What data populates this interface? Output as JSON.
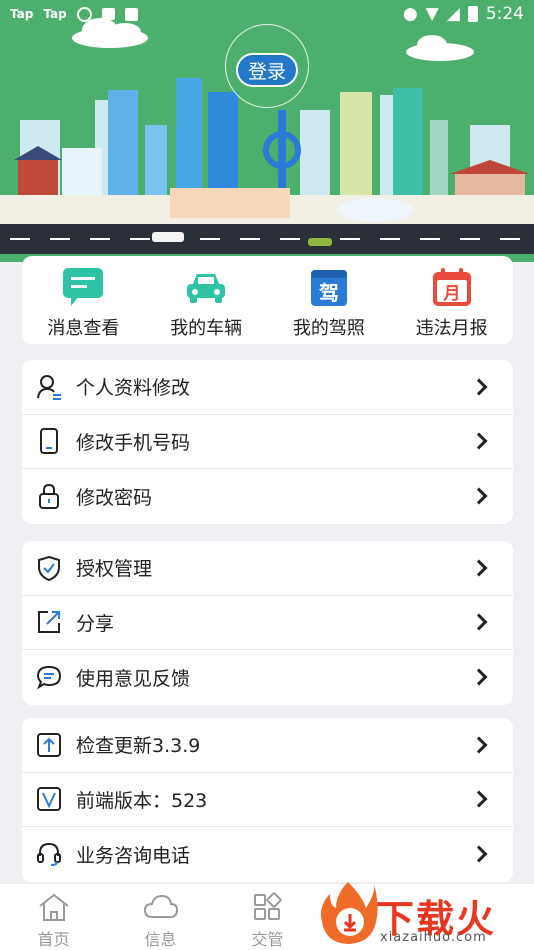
{
  "status_bar": {
    "left": [
      "Tap",
      "Tap"
    ],
    "time": "5:24"
  },
  "header": {
    "login_label": "登录"
  },
  "quick_menu": [
    {
      "label": "消息查看",
      "icon": "message-icon",
      "color": "#2ec3a4"
    },
    {
      "label": "我的车辆",
      "icon": "car-icon",
      "color": "#2ec3a4"
    },
    {
      "label": "我的驾照",
      "icon": "license-icon",
      "color": "#2b7bd6"
    },
    {
      "label": "违法月报",
      "icon": "calendar-icon",
      "color": "#e84a3c"
    }
  ],
  "group1": [
    {
      "label": "个人资料修改",
      "icon": "profile-icon"
    },
    {
      "label": "修改手机号码",
      "icon": "phone-icon"
    },
    {
      "label": "修改密码",
      "icon": "lock-icon"
    }
  ],
  "group2": [
    {
      "label": "授权管理",
      "icon": "shield-icon"
    },
    {
      "label": "分享",
      "icon": "share-icon"
    },
    {
      "label": "使用意见反馈",
      "icon": "feedback-icon"
    }
  ],
  "group3": [
    {
      "label": "检查更新3.3.9",
      "icon": "update-icon"
    },
    {
      "label": "前端版本：523",
      "icon": "version-icon"
    },
    {
      "label": "业务咨询电话",
      "icon": "headset-icon"
    }
  ],
  "bottom_nav": [
    {
      "label": "首页",
      "icon": "home-icon"
    },
    {
      "label": "信息",
      "icon": "cloud-icon"
    },
    {
      "label": "交管",
      "icon": "grid-icon"
    }
  ],
  "watermark": {
    "title": "下载火",
    "subtitle": "xiazaihuo.com"
  },
  "colors": {
    "header_green": "#4caf6e",
    "login_blue": "#2378c7"
  }
}
